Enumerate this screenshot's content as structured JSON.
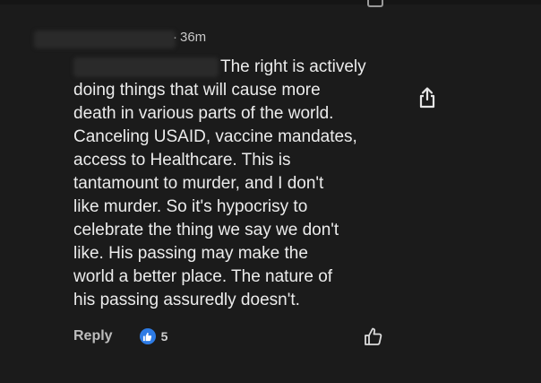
{
  "comment": {
    "time_ago": "36m",
    "separator": "·",
    "text": "The right is actively\ndoing things that will cause more\ndeath in various parts of the world.\nCanceling USAID, vaccine mandates,\naccess to Healthcare. This is\ntantamount to murder, and I don't\nlike murder. So it's hypocrisy to\ncelebrate the thing we say we don't\nlike. His passing may make the\nworld a better place. The nature of\nhis passing assuredly doesn't."
  },
  "actions": {
    "reply_label": "Reply",
    "like_count": "5"
  },
  "icons": {
    "share": "share-icon",
    "like_reaction": "thumbs-up-icon",
    "like_button": "thumbs-up-outline-icon"
  },
  "colors": {
    "background": "#1b1b1b",
    "text": "#ececec",
    "like_blue": "#2d7be5"
  }
}
